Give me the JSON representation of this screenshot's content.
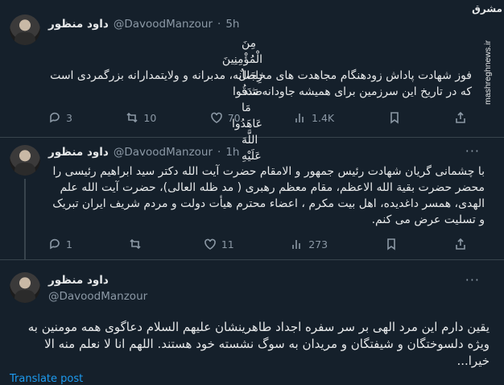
{
  "tweets": [
    {
      "name": "داود منظور",
      "handle": "@DavoodManzour",
      "dot": "·",
      "time": "5h",
      "verse": "مِنَ الْمُؤْمِنِينَ رِجَالٌ صَدَقُوا مَا عَاهَدُوا اللَّهَ عَلَيْهِ",
      "text": "فوز شهادت پاداش زودهنگام مجاهدت های مخلصانه، مدبرانه و ولایتمدارانه بزرگمردی است که در تاریخ این سرزمین برای همیشه جاودانه شد.",
      "replies": "3",
      "retweets": "10",
      "likes": "70",
      "views": "1.4K"
    },
    {
      "name": "داود منظور",
      "handle": "@DavoodManzour",
      "dot": "·",
      "time": "1h",
      "text": "با چشمانی گریان شهادت رئیس جمهور و الامقام حضرت آیت الله دکتر سید ابراهیم رئیسی را محضر حضرت بقیة الله الاعظم، مقام معظم رهبری ( مد ظله العالی)، حضرت آیت الله علم الهدی، همسر داغدیده، اهل بیت مکرم ، اعضاء محترم هیأت دولت و مردم شریف ایران تبریک و تسلیت عرض می کنم.",
      "replies": "1",
      "retweets": "",
      "likes": "11",
      "views": "273"
    },
    {
      "name": "داود منظور",
      "handle": "@DavoodManzour",
      "text": "یقین دارم این مرد الهی بر سر سفره اجداد طاهرینشان علیهم السلام دعاگوی همه مومنین به ویژه دلسوختگان و شیفتگان و مریدان به سوگ نشسته خود هستند. اللهم انا لا نعلم منه الا خیرا..."
    }
  ],
  "more_label": "···",
  "translate_label": "Translate post",
  "watermark": {
    "logo": "مشرق",
    "site": "mashreghnews.ir"
  }
}
